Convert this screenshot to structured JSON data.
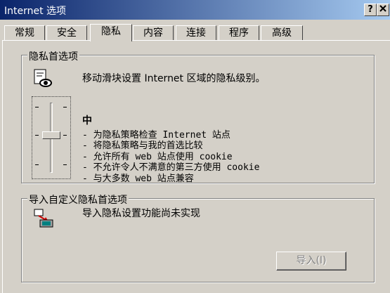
{
  "window": {
    "title": "Internet 选项",
    "help_btn": "?",
    "close_btn": "X"
  },
  "tabs": [
    {
      "label": "常规"
    },
    {
      "label": "安全"
    },
    {
      "label": "隐私"
    },
    {
      "label": "内容"
    },
    {
      "label": "连接"
    },
    {
      "label": "程序"
    },
    {
      "label": "高级"
    }
  ],
  "active_tab": "隐私",
  "privacy_settings": {
    "legend": "隐私首选项",
    "description": "移动滑块设置 Internet 区域的隐私级别。",
    "level": "中",
    "bullets": [
      "- 为隐私策略检查 Internet 站点",
      "- 将隐私策略与我的首选比较",
      "- 允许所有 web 站点使用 cookie",
      "- 不允许令人不满意的第三方使用 cookie",
      "- 与大多数 web 站点兼容"
    ],
    "slider_icon": "privacy-report-icon"
  },
  "import_section": {
    "legend": "导入自定义隐私首选项",
    "message": "导入隐私设置功能尚未实现",
    "import_button": "导入(I)",
    "import_icon": "computer-import-icon"
  }
}
